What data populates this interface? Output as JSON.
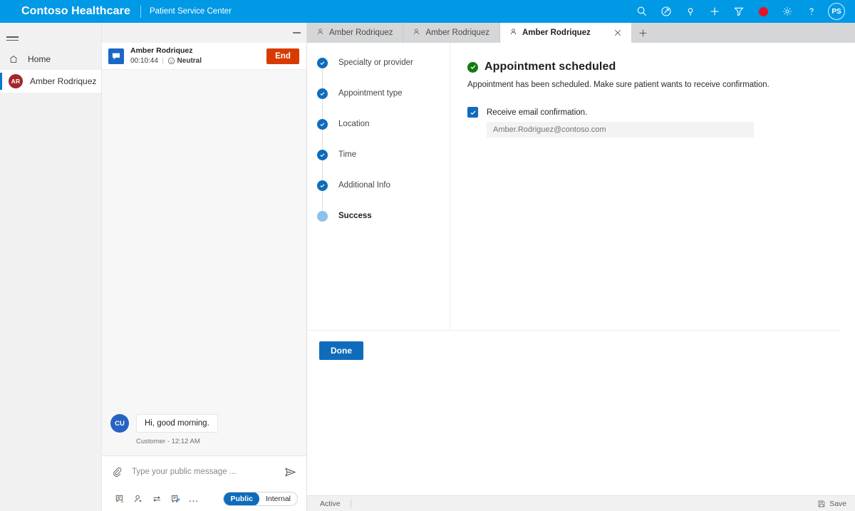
{
  "brand": {
    "title": "Contoso Healthcare",
    "subtitle": "Patient Service Center",
    "bar_color": "#0099e6",
    "actions": [
      {
        "name": "search-icon",
        "label": "Search"
      },
      {
        "name": "assist-icon",
        "label": "Assist"
      },
      {
        "name": "lightbulb-icon",
        "label": "Insights"
      },
      {
        "name": "plus-icon",
        "label": "New"
      },
      {
        "name": "filter-icon",
        "label": "Filter"
      },
      {
        "name": "record-icon",
        "label": "Recording",
        "color": "#e81123"
      },
      {
        "name": "gear-icon",
        "label": "Settings"
      },
      {
        "name": "help-icon",
        "label": "Help"
      }
    ],
    "user_initials": "PS"
  },
  "rail": {
    "menu_label": "Menu",
    "items": [
      {
        "label": "Home",
        "icon": "home-icon",
        "selected": false
      },
      {
        "label": "Amber Rodriquez",
        "icon": "avatar",
        "initials": "AR",
        "avatar_color": "#a4262c",
        "selected": true
      }
    ]
  },
  "conversation": {
    "minimize_label": "Minimize",
    "channel_icon": "chat-icon",
    "customer_name": "Amber Rodriquez",
    "timer": "00:10:44",
    "separator": "|",
    "sentiment_icon": "neutral-face-icon",
    "sentiment": "Neutral",
    "end_button": "End",
    "end_button_color": "#d83b01",
    "messages": [
      {
        "avatar_initials": "CU",
        "avatar_color": "#2862c4",
        "text": "Hi, good morning.",
        "footer": "Customer - 12:12 AM"
      }
    ],
    "composer": {
      "attach_icon": "paperclip-icon",
      "placeholder": "Type your public message ...",
      "value": "",
      "send_icon": "send-icon",
      "tools": [
        {
          "name": "quick-reply-icon",
          "label": "Quick replies"
        },
        {
          "name": "add-agent-icon",
          "label": "Consult"
        },
        {
          "name": "transfer-icon",
          "label": "Transfer"
        },
        {
          "name": "notes-icon",
          "label": "Notes"
        },
        {
          "name": "more-icon",
          "label": "More",
          "glyph": "…"
        }
      ],
      "visibility": {
        "public": "Public",
        "internal": "Internal",
        "selected": "Public"
      }
    }
  },
  "main": {
    "tabs": [
      {
        "label": "Amber Rodriquez",
        "icon": "person-icon",
        "active": false,
        "closable": false
      },
      {
        "label": "Amber Rodriquez",
        "icon": "person-icon",
        "active": false,
        "closable": false
      },
      {
        "label": "Amber Rodriquez",
        "icon": "person-icon",
        "active": true,
        "closable": true
      }
    ],
    "add_tab_label": "New tab",
    "stepper": [
      {
        "label": "Specialty or provider",
        "state": "complete"
      },
      {
        "label": "Appointment type",
        "state": "complete"
      },
      {
        "label": "Location",
        "state": "complete"
      },
      {
        "label": "Time",
        "state": "complete"
      },
      {
        "label": "Additional Info",
        "state": "complete"
      },
      {
        "label": "Success",
        "state": "current"
      }
    ],
    "pane": {
      "status_icon": "success-check-icon",
      "status_color": "#107c10",
      "title": "Appointment scheduled",
      "description": "Appointment has been scheduled. Make sure patient wants to receive confirmation.",
      "checkbox": {
        "label": "Receive email confirmation.",
        "checked": true
      },
      "email": {
        "value": "",
        "placeholder": "Amber.Rodriguez@contoso.com"
      },
      "done_button": "Done",
      "done_button_color": "#0f6cbd"
    }
  },
  "statusbar": {
    "state": "Active",
    "save_icon": "save-icon",
    "save_label": "Save"
  }
}
